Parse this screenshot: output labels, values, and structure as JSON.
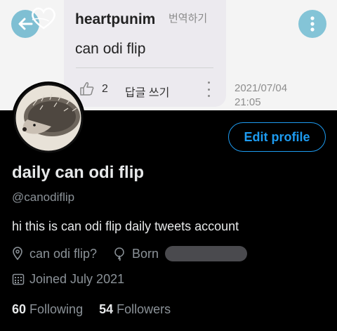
{
  "comment": {
    "username": "heartpunim",
    "translate_label": "번역하기",
    "text": "can odi flip",
    "like_count": "2",
    "reply_label": "답글 쓰기",
    "date": "2021/07/04",
    "time": "21:05"
  },
  "profile": {
    "edit_button": "Edit profile",
    "display_name": "daily can odi flip",
    "handle": "@canodiflip",
    "bio": "hi this is can odi flip daily tweets account",
    "location": "can odi flip?",
    "born_label": "Born",
    "joined": "Joined July 2021",
    "following_count": "60",
    "following_label": "Following",
    "followers_count": "54",
    "followers_label": "Followers"
  },
  "colors": {
    "accent": "#1d9bf0",
    "button_teal": "#7fbfd3"
  },
  "icons": [
    "back-arrow-icon",
    "heart-logo-icon",
    "more-vertical-icon",
    "thumbs-up-icon",
    "location-pin-icon",
    "balloon-icon",
    "calendar-icon"
  ]
}
